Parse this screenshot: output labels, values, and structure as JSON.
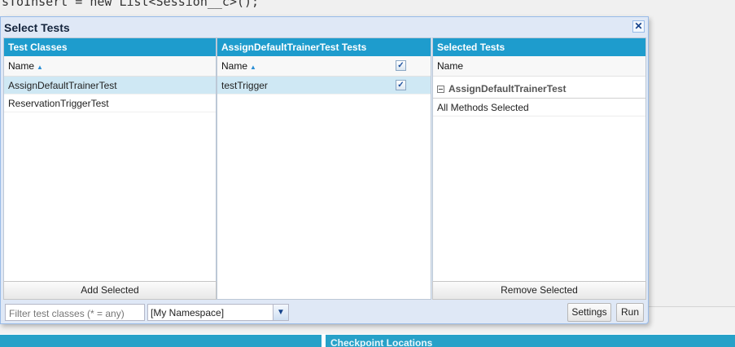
{
  "background": {
    "code_line": "sToInsert = new List<Session__c>();",
    "bottom_panel_title": "Checkpoint Locations"
  },
  "dialog": {
    "title": "Select Tests",
    "close_icon": "close-icon"
  },
  "test_classes": {
    "header": "Test Classes",
    "column": "Name",
    "rows": [
      "AssignDefaultTrainerTest",
      "ReservationTriggerTest"
    ],
    "selected_index": 0,
    "button": "Add Selected"
  },
  "methods": {
    "header": "AssignDefaultTrainerTest Tests",
    "column": "Name",
    "header_checked": true,
    "rows": [
      {
        "name": "testTrigger",
        "checked": true
      }
    ]
  },
  "selected_tests": {
    "header": "Selected Tests",
    "column": "Name",
    "group": "AssignDefaultTrainerTest",
    "group_detail": "All Methods Selected",
    "button": "Remove Selected"
  },
  "footer": {
    "filter_placeholder": "Filter test classes (* = any)",
    "namespace_value": "[My Namespace]",
    "settings_label": "Settings",
    "run_label": "Run"
  },
  "colors": {
    "header_blue": "#1e9ccd",
    "selection": "#cfe8f4"
  }
}
